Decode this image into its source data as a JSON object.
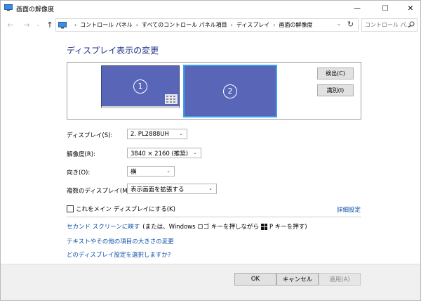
{
  "window": {
    "title": "画面の解像度",
    "min_glyph": "—",
    "max_glyph": "☐",
    "close_glyph": "✕"
  },
  "nav": {
    "back_glyph": "←",
    "forward_glyph": "→",
    "recent_glyph": "⌄",
    "up_glyph": "↑",
    "breadcrumbs": [
      "コントロール パネル",
      "すべてのコントロール パネル項目",
      "ディスプレイ",
      "画面の解像度"
    ],
    "separator": "›",
    "dropdown_glyph": "⌄",
    "refresh_glyph": "↻",
    "search_placeholder": "コントロール パ..."
  },
  "main": {
    "title": "ディスプレイ表示の変更",
    "monitors": [
      {
        "number": "1"
      },
      {
        "number": "2"
      }
    ],
    "detect_label": "検出(C)",
    "identify_label": "識別(I)",
    "settings": [
      {
        "label": "ディスプレイ(S):",
        "value": "2. PL2888UH"
      },
      {
        "label": "解像度(R):",
        "value": "3840 × 2160 (推奨)"
      },
      {
        "label": "向き(O):",
        "value": "横"
      },
      {
        "label": "複数のディスプレイ(M):",
        "value": "表示画面を拡張する"
      }
    ],
    "make_main_label": "これをメイン ディスプレイにする(K)",
    "advanced_link": "詳細設定",
    "second_screen_link": "セカンド スクリーンに映す",
    "second_screen_text_a": "(または、Windows ロゴ キーを押しながら",
    "second_screen_text_b": "P キーを押す)",
    "text_size_link": "テキストやその他の項目の大きさの変更",
    "which_settings_link": "どのディスプレイ設定を選択しますか?"
  },
  "footer": {
    "ok_label": "OK",
    "cancel_label": "キャンセル",
    "apply_label": "適用(A)"
  },
  "colors": {
    "accent_title": "#1e3287",
    "link": "#0f4fa8",
    "monitor_fill": "#5966b8",
    "selected_border": "#3aa0f0"
  }
}
